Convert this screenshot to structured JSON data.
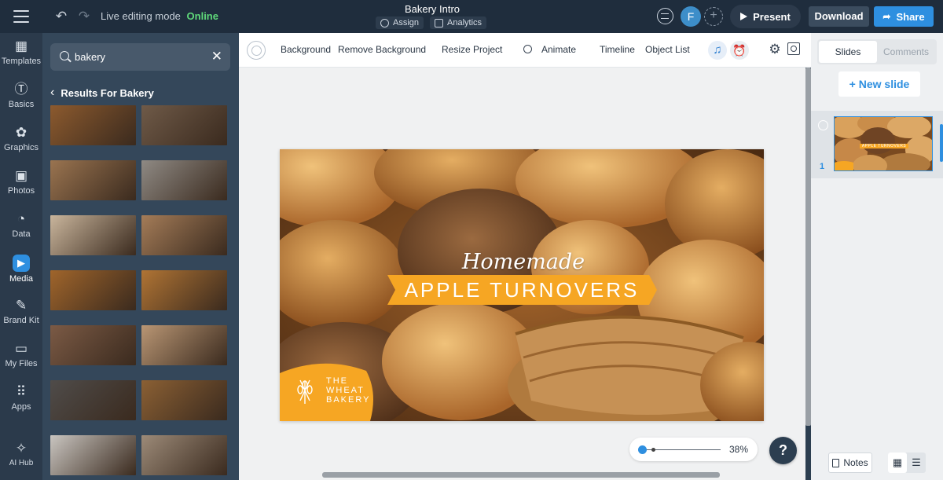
{
  "header": {
    "mode_label": "Live editing mode",
    "mode_status": "Online",
    "title": "Bakery Intro",
    "assign_label": "Assign",
    "analytics_label": "Analytics",
    "avatar_initial": "F",
    "present_label": "Present",
    "download_label": "Download",
    "share_label": "Share"
  },
  "sidebar": {
    "items": [
      {
        "label": "Templates",
        "icon": "templates-icon"
      },
      {
        "label": "Basics",
        "icon": "basics-icon"
      },
      {
        "label": "Graphics",
        "icon": "graphics-icon"
      },
      {
        "label": "Photos",
        "icon": "photos-icon"
      },
      {
        "label": "Data",
        "icon": "data-icon"
      },
      {
        "label": "Media",
        "icon": "media-icon"
      },
      {
        "label": "Brand Kit",
        "icon": "brand-kit-icon"
      },
      {
        "label": "My Files",
        "icon": "folder-icon"
      },
      {
        "label": "Apps",
        "icon": "apps-icon"
      },
      {
        "label": "AI Hub",
        "icon": "sparkle-icon"
      }
    ]
  },
  "media_panel": {
    "search_value": "bakery",
    "results_heading": "Results For Bakery",
    "thumbnail_colors": [
      "#8c5a2e",
      "#6f5a48",
      "#9a7450",
      "#8f8a84",
      "#c9b59c",
      "#a47c58",
      "#a0652b",
      "#b07434",
      "#7b5a45",
      "#b99674",
      "#4f4c4a",
      "#8b6034",
      "#c9c5c0",
      "#9c8a78"
    ]
  },
  "toolbar": {
    "background": "Background",
    "remove_background": "Remove Background",
    "resize_project": "Resize Project",
    "animate": "Animate",
    "timeline": "Timeline",
    "object_list": "Object List"
  },
  "slide": {
    "script_text": "Homemade",
    "banner_text": "APPLE TURNOVERS",
    "brand_line1": "THE",
    "brand_line2": "WHEAT",
    "brand_line3": "BAKERY",
    "banner_color": "#f6a623"
  },
  "zoom": {
    "value": "38%",
    "level": 0.38
  },
  "right_panel": {
    "tab_slides": "Slides",
    "tab_comments": "Comments",
    "new_slide": "+ New slide",
    "slide_number": "1",
    "thumb_text": "APPLE TURNOVERS",
    "notes_label": "Notes"
  },
  "help_label": "?"
}
